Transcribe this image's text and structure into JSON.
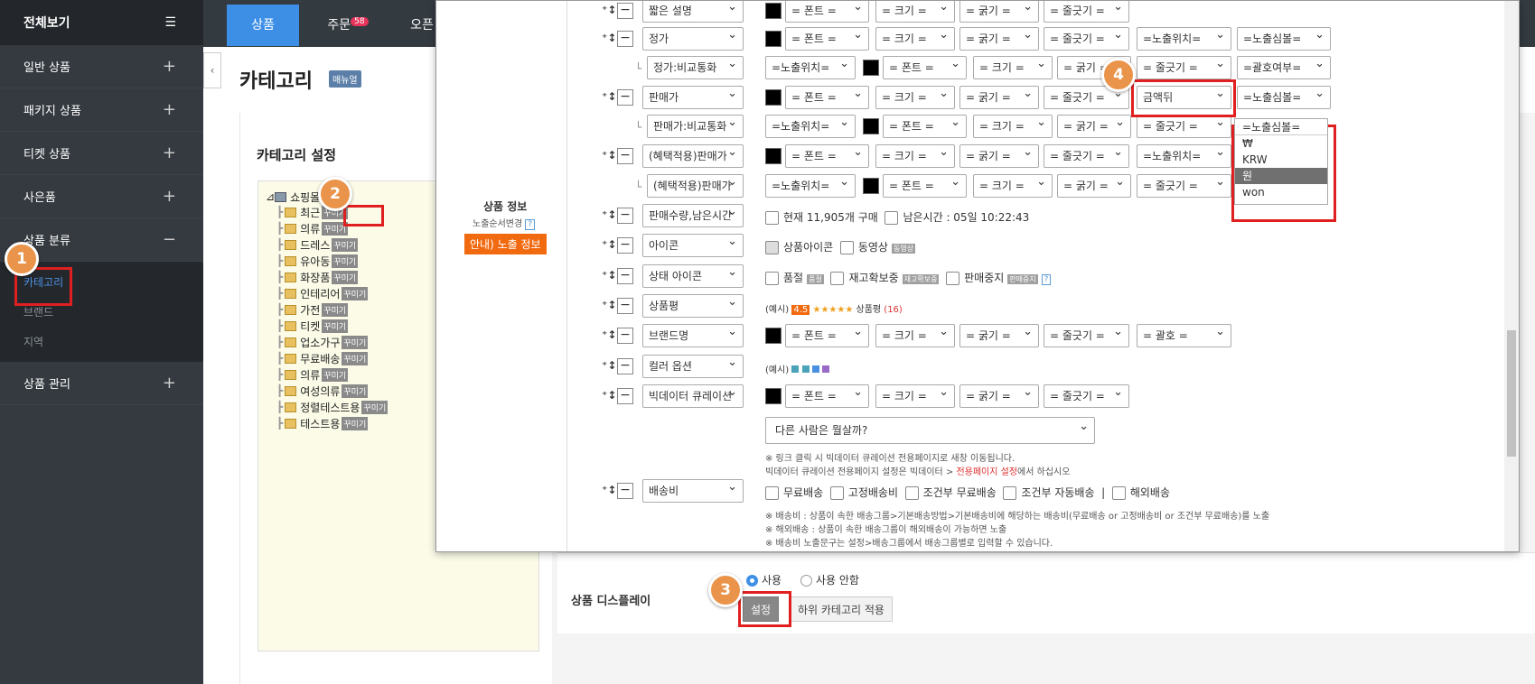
{
  "sidebar": {
    "title": "전체보기",
    "items": [
      {
        "label": "일반 상품",
        "sign": "+"
      },
      {
        "label": "패키지 상품",
        "sign": "+"
      },
      {
        "label": "티켓 상품",
        "sign": "+"
      },
      {
        "label": "사은품",
        "sign": "+"
      },
      {
        "label": "상품 분류",
        "sign": "−"
      }
    ],
    "sub": [
      "카테고리",
      "브랜드",
      "지역"
    ],
    "last": {
      "label": "상품 관리",
      "sign": "+"
    }
  },
  "topnav": {
    "tabs": [
      "상품",
      "주문",
      "오픈"
    ],
    "order_badge": "58"
  },
  "page": {
    "title": "카테고리",
    "manual": "매뉴얼",
    "section": "카테고리 설정"
  },
  "tree": {
    "root": "쇼핑몰",
    "deco": "꾸미기",
    "cats": [
      "최근",
      "의류",
      "드레스",
      "유아동",
      "화장품",
      "인테리어",
      "가전",
      "티켓",
      "업소가구",
      "무료배송",
      "의류",
      "여성의류",
      "정렬테스트용",
      "테스트용"
    ]
  },
  "display": {
    "label": "상품 디스플레이",
    "use": "사용",
    "nouse": "사용 안함",
    "set_btn": "설정",
    "child_btn": "하위 카테고리 적용"
  },
  "popup": {
    "left_title": "상품 정보",
    "left_sub": "노출순서변경",
    "help": "?",
    "guide_btn": "안내) 노출 정보"
  },
  "opts": {
    "font": "= 폰트 =",
    "size": "= 크기 =",
    "weight": "= 굵기 =",
    "line": "= 줄긋기 =",
    "pos": "=노출위치=",
    "sym": "=노출심볼=",
    "paren": "=괄호여부=",
    "paren2": "= 괄호 =",
    "amount": "금액뒤"
  },
  "rows": [
    "짧은 설명",
    "정가",
    "정가:비교통화",
    "판매가",
    "판매가:비교통화",
    "(혜택적용)판매가",
    "(혜택적용)판매가",
    "판매수량,남은시간",
    "아이콘",
    "상태 아이콘",
    "상품평",
    "브랜드명",
    "컬러 옵션",
    "빅데이터 큐레이션",
    "배송비"
  ],
  "sales": {
    "text1": "현재 11,905개 구매",
    "text2": "남은시간 : 05일 10:22:43"
  },
  "icons": {
    "a": "상품아이콘",
    "b": "동영상",
    "b_tag": "동영상"
  },
  "status": {
    "a": "품절",
    "a_tag": "품절",
    "b": "재고확보중",
    "b_tag": "재고확보중",
    "c": "판매중지",
    "c_tag": "판매중지"
  },
  "review": {
    "ex": "(예시)",
    "score": "4.5",
    "stars": "★★★★★",
    "label": "상품평",
    "count": "(16)"
  },
  "color_ex": "(예시)",
  "bigdata": {
    "input": "다른 사람은 뭘살까?",
    "note1": "※ 링크 클릭 시 빅데이터 큐레이션 전용페이지로 새창 이동됩니다.",
    "note2a": "빅데이터 큐레이션 전용페이지 설정은 빅데이터 > ",
    "note2b": "전용페이지 설정",
    "note2c": "에서 하십시오"
  },
  "ship": {
    "a": "무료배송",
    "b": "고정배송비",
    "c": "조건부 무료배송",
    "d": "조건부 자동배송",
    "sep": "|",
    "e": "해외배송",
    "n1": "※ 배송비 : 상품이 속한 배송그룹>기본배송방법>기본배송비에 해당하는 배송비(무료배송 or 고정배송비 or 조건부 무료배송)를 노출",
    "n2": "※ 해외배송 : 상품이 속한 배송그룹이 해외배송이 가능하면 노출",
    "n3": "※ 배송비 노출문구는 설정>배송그룹에서 배송그룹별로 입력할 수 있습니다."
  },
  "dropdown": {
    "head": "=노출심볼=",
    "items": [
      "₩",
      "KRW",
      "원",
      "won"
    ]
  },
  "callouts": [
    "1",
    "2",
    "3",
    "4"
  ]
}
